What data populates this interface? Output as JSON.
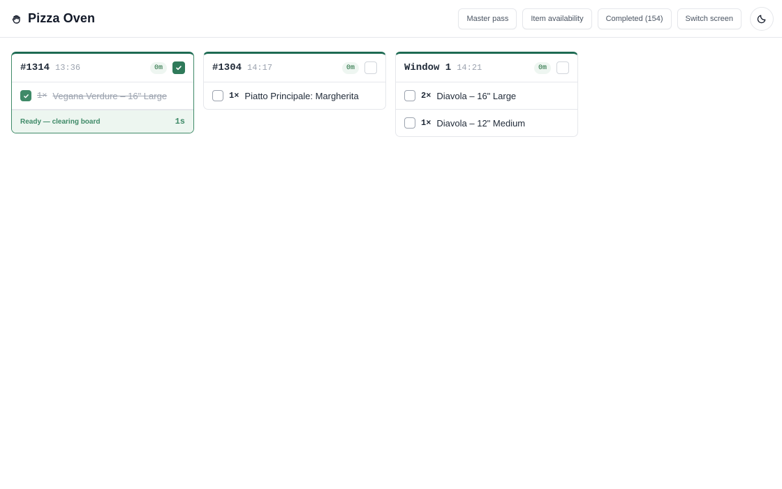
{
  "app": {
    "title": "Pizza Oven",
    "icon": "hand-icon"
  },
  "toolbar": {
    "master_pass": "Master pass",
    "item_availability": "Item availability",
    "completed": "Completed (154)",
    "switch_screen": "Switch screen",
    "theme_icon": "moon-icon"
  },
  "colors": {
    "accent": "#1e6b53",
    "ready_bg": "#edf6f0",
    "ready_text": "#3f8a68"
  },
  "orders": [
    {
      "id": "#1314",
      "time": "13:36",
      "elapsed": "0m",
      "checked": true,
      "items": [
        {
          "qty": "1×",
          "name": "Vegana Verdure – 16\" Large",
          "done": true
        }
      ],
      "status": {
        "text": "Ready — clearing board",
        "timer": "1s"
      }
    },
    {
      "id": "#1304",
      "time": "14:17",
      "elapsed": "0m",
      "checked": false,
      "items": [
        {
          "qty": "1×",
          "name": "Piatto Principale: Margherita",
          "done": false
        }
      ]
    },
    {
      "id": "Window 1",
      "time": "14:21",
      "elapsed": "0m",
      "checked": false,
      "items": [
        {
          "qty": "2×",
          "name": "Diavola – 16\" Large",
          "done": false
        },
        {
          "qty": "1×",
          "name": "Diavola – 12\" Medium",
          "done": false
        }
      ]
    }
  ]
}
